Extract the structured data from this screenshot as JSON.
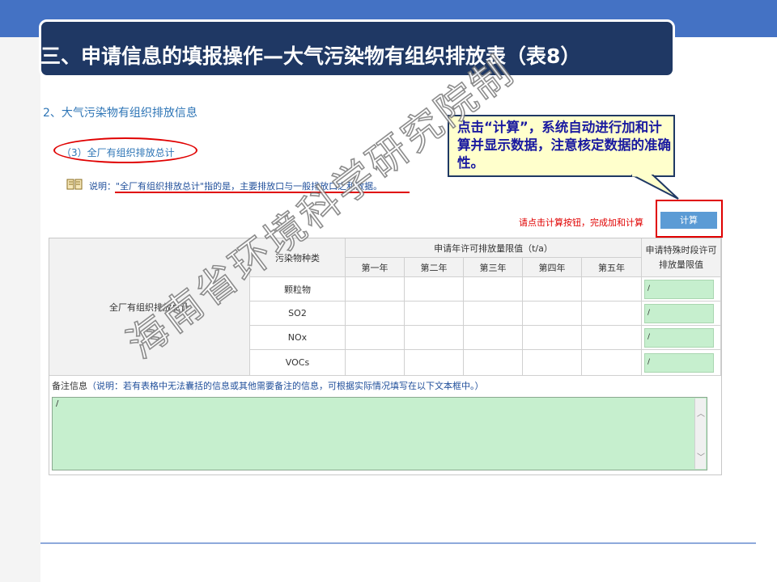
{
  "slide": {
    "title": "三、申请信息的填报操作—大气污染物有组织排放表（表8）",
    "colors": {
      "header_bg": "#1f3864",
      "top_band": "#4472c4",
      "accent_red": "#e00000",
      "link_blue": "#2e75b6",
      "field_green": "#c6efce",
      "button_blue": "#5b9bd5"
    }
  },
  "form": {
    "section_title": "2、大气污染物有组织排放信息",
    "sub_title": "（3）全厂有组织排放总计",
    "note": {
      "label": "说明：",
      "text": "\"全厂有组织排放总计\"指的是，主要排放口与一般排放口之和数据。"
    },
    "hint": "请点击计算按钮，完成加和计算",
    "calc_button": "计算"
  },
  "callout": {
    "text": "点击“计算”，系统自动进行加和计算并显示数据，注意核定数据的准确性。"
  },
  "table": {
    "row_header": "全厂有组织排放总计",
    "col_pollutant": "污染物种类",
    "col_group": "申请年许可排放量限值（t/a）",
    "years": [
      "第一年",
      "第二年",
      "第三年",
      "第四年",
      "第五年"
    ],
    "col_special": "申请特殊时段许可排放量限值",
    "pollutants": [
      "颗粒物",
      "SO2",
      "NOx",
      "VOCs"
    ],
    "special_values": [
      "/",
      "/",
      "/",
      "/"
    ]
  },
  "remark": {
    "label": "备注信息",
    "hint": "（说明：若有表格中无法囊括的信息或其他需要备注的信息，可根据实际情况填写在以下文本框中。）",
    "value": "/"
  },
  "watermark": "海南省环境科学研究院制"
}
